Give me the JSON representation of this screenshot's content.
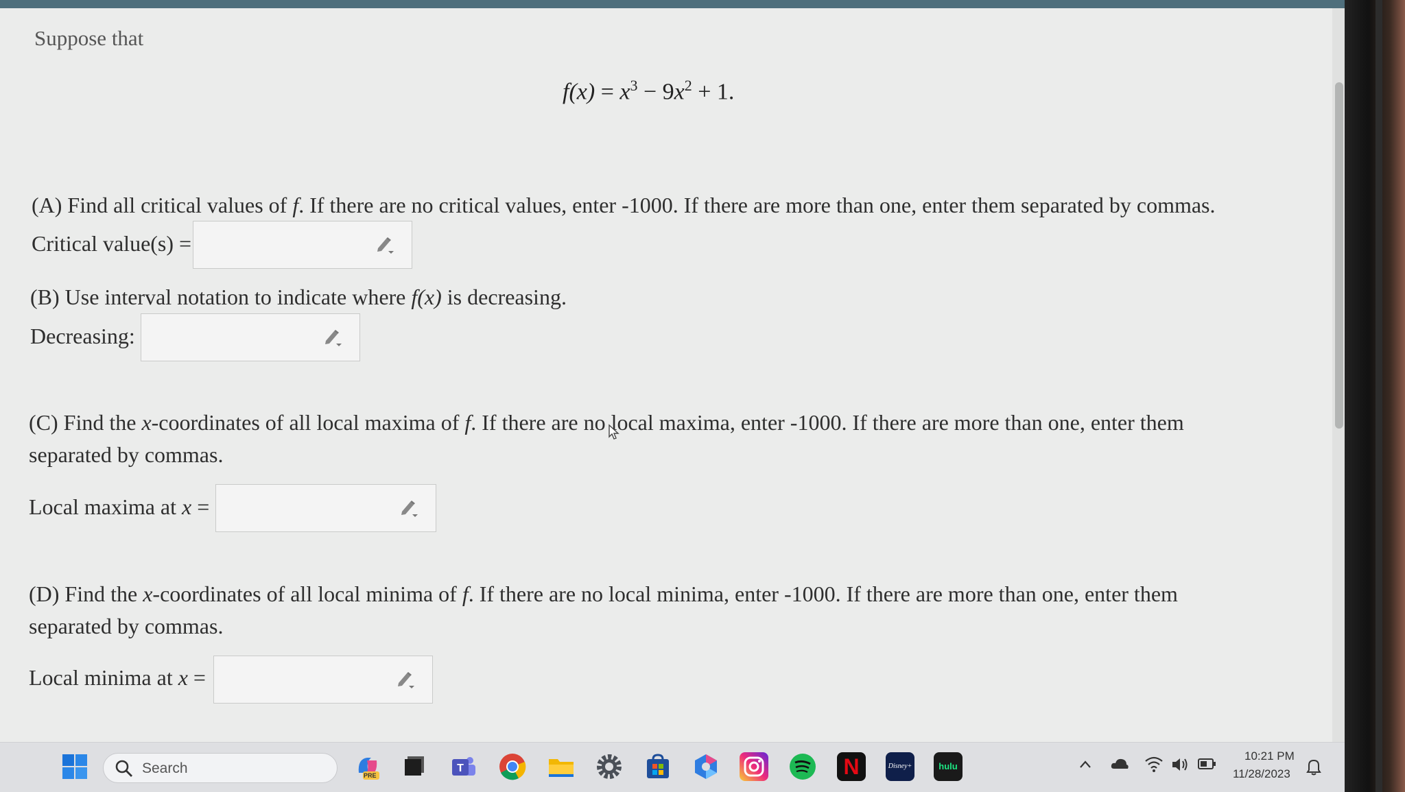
{
  "intro": "Suppose that",
  "formula": {
    "lhs": "f(x)",
    "eq": " = ",
    "t1": "x",
    "e1": "3",
    "t2": " − 9",
    "t3": "x",
    "e2": "2",
    "rest": " + 1."
  },
  "part_a": {
    "p1": "(A) Find all critical values of ",
    "f": "f",
    "p2": ". If there are no critical values, enter -1000. If there are more than one, enter them separated by commas.",
    "label": "Critical value(s) ="
  },
  "part_b": {
    "p1": "(B) Use interval notation to indicate where ",
    "fx": "f(x)",
    "p2": " is decreasing.",
    "label": "Decreasing:"
  },
  "part_c": {
    "p1": "(C) Find the ",
    "x": "x",
    "p2": "-coordinates of all local maxima of ",
    "f": "f",
    "p3": ". If there are no local maxima, enter -1000. If there are more than one, enter them separated by commas.",
    "label": "Local maxima at ",
    "label_x": "x",
    "label_eq": " ="
  },
  "part_d": {
    "p1": "(D) Find the ",
    "x": "x",
    "p2": "-coordinates of all local minima of ",
    "f": "f",
    "p3": ". If there are no local minima, enter -1000. If there are more than one, enter them separated by commas.",
    "label": "Local minima at ",
    "label_x": "x",
    "label_eq": " ="
  },
  "inputs": {
    "critical": "",
    "decreasing": "",
    "maxima": "",
    "minima": ""
  },
  "taskbar": {
    "search_placeholder": "Search",
    "apps": [
      "start-icon",
      "copilot-icon",
      "task-view-icon",
      "teams-icon",
      "chrome-icon",
      "file-explorer-icon",
      "settings-icon",
      "microsoft-store-icon",
      "office-icon",
      "instagram-icon",
      "spotify-icon",
      "netflix-icon",
      "disney-plus-icon",
      "hulu-icon"
    ],
    "netflix_label": "N",
    "disney_label": "Disney+",
    "hulu_label": "hulu",
    "copilot_badge": "PRE",
    "time": "10:21 PM",
    "date": "11/28/2023"
  },
  "colors": {
    "page_bg": "#ebeceb",
    "taskbar_bg": "#dedfe2",
    "accent": "#4f6f7c"
  }
}
